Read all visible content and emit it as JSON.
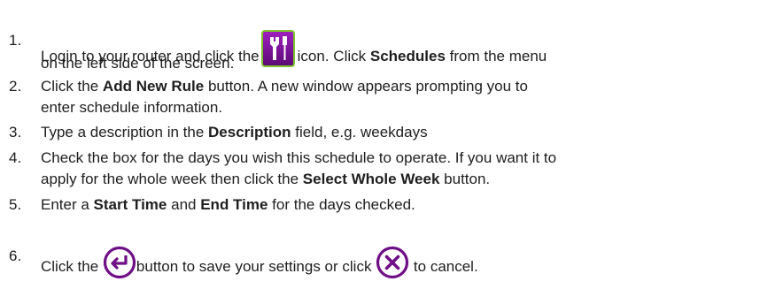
{
  "steps": [
    {
      "number": "1.",
      "pre": "Login to your router and click the",
      "icon": "tools-icon",
      "post_a": "icon. Click",
      "bold_a": "Schedules",
      "post_b": "from the menu",
      "line2": "on the left side of the screen."
    },
    {
      "number": "2.",
      "pre": "Click the",
      "bold_a": "Add New Rule",
      "post_a": "button. A new window appears prompting you to",
      "line2": "enter schedule information."
    },
    {
      "number": "3.",
      "pre": "Type a description in the",
      "bold_a": "Description",
      "post_a": "field, e.g. weekdays"
    },
    {
      "number": "4.",
      "pre": "Check the box for the days you wish this schedule to operate. If you want it to",
      "line2_pre": "apply for the whole week then click the",
      "line2_bold": "Select Whole Week",
      "line2_post": "button."
    },
    {
      "number": "5.",
      "pre": "Enter a",
      "bold_a": "Start Time",
      "mid": "and",
      "bold_b": "End Time",
      "post": "for the days checked."
    },
    {
      "number": "6.",
      "pre": "Click the",
      "icon_a": "save-arrow-icon",
      "mid": "button to save your settings or click",
      "icon_b": "cancel-x-icon",
      "post": "to cancel."
    }
  ],
  "colors": {
    "text": "#1e1e1e",
    "icon_purple": "#6f0f86",
    "icon_green": "#7fc32e"
  }
}
